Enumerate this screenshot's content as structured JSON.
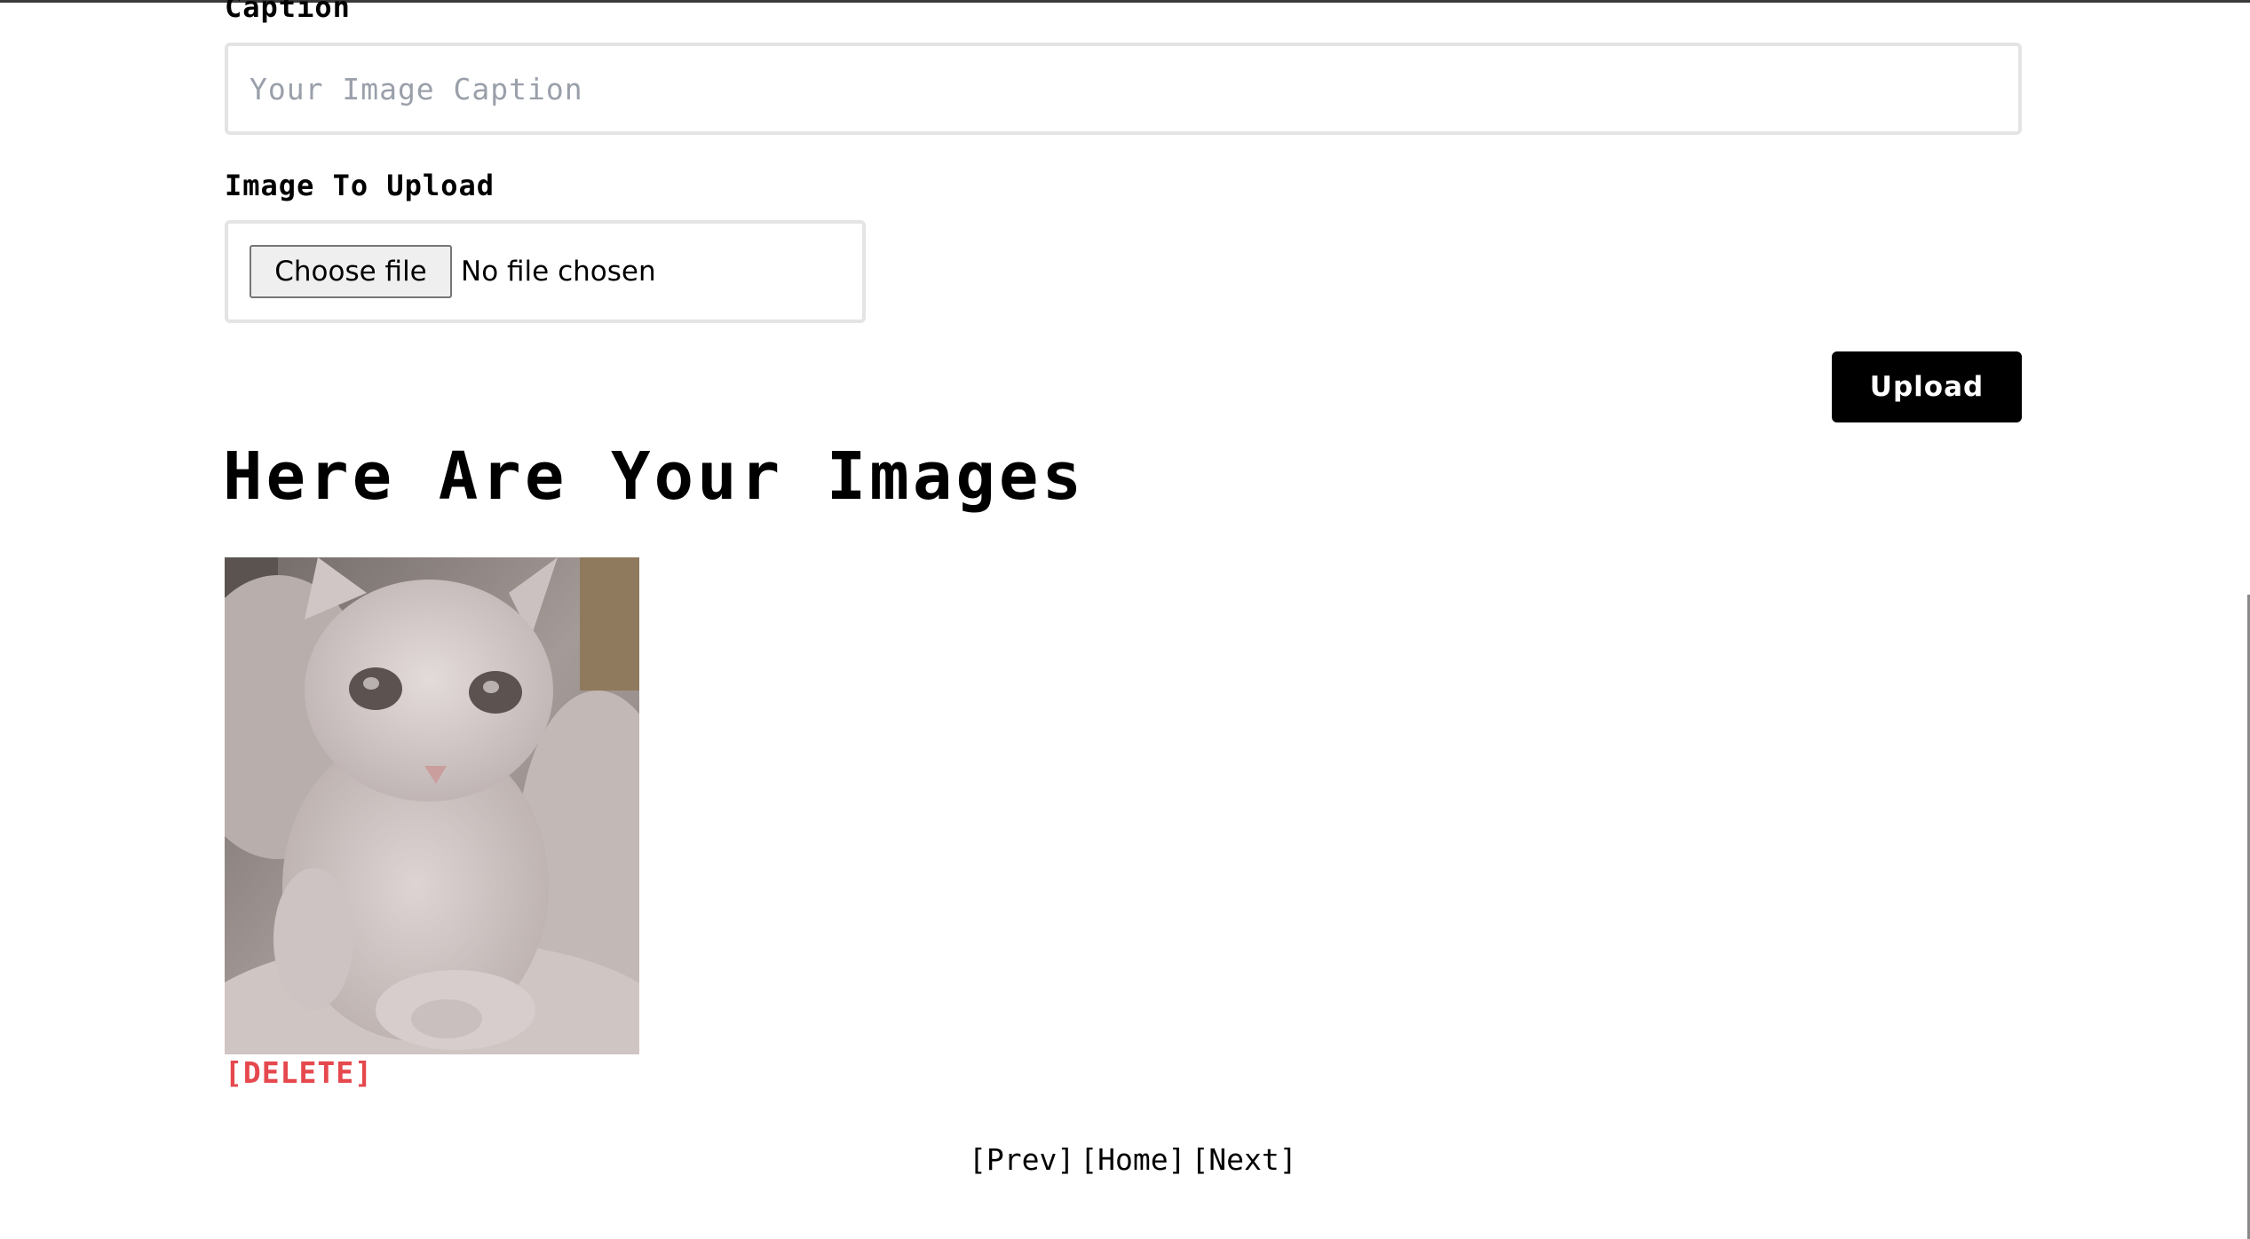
{
  "form": {
    "caption_label": "Caption",
    "caption_placeholder": "Your Image Caption",
    "caption_value": "",
    "upload_label": "Image To Upload",
    "choose_file_label": "Choose file",
    "no_file_text": "No file chosen",
    "upload_button_label": "Upload"
  },
  "gallery": {
    "heading": "Here Are Your Images",
    "images": [
      {
        "alt": "",
        "delete_label": "[DELETE]"
      }
    ]
  },
  "pagination": {
    "prev_label": "[Prev]",
    "home_label": "[Home]",
    "next_label": "[Next]"
  },
  "colors": {
    "delete": "#e5484d",
    "button_bg": "#000000",
    "input_border": "#e4e4e4",
    "placeholder": "#9aa0aa"
  }
}
